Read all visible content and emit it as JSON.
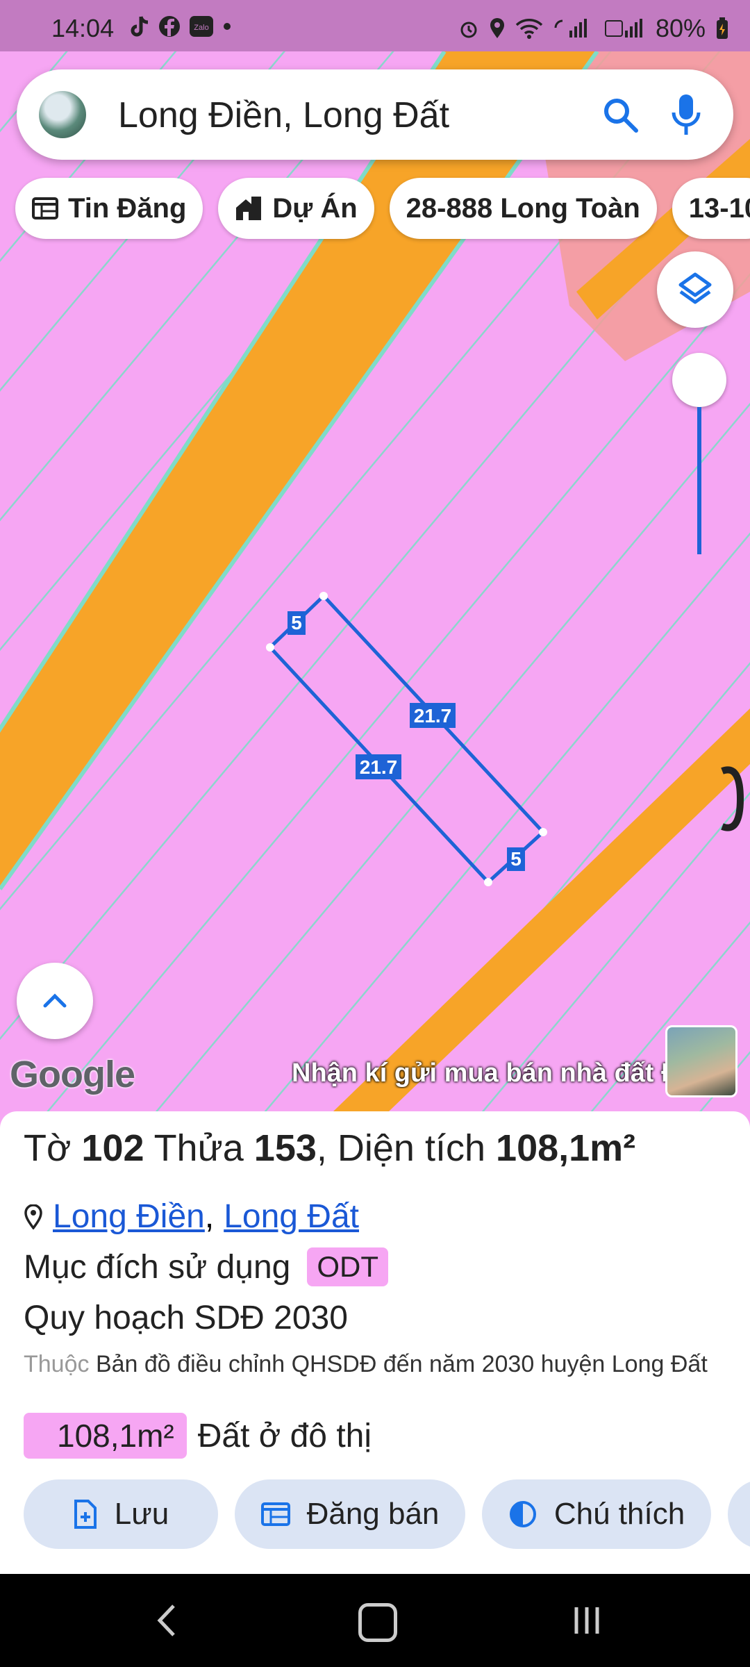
{
  "status_bar": {
    "time": "14:04",
    "battery": "80%",
    "app_icons": [
      "tiktok-icon",
      "facebook-icon",
      "zalo-icon"
    ],
    "zalo_label": "Zalo"
  },
  "search": {
    "text": "Long Điền, Long Đất"
  },
  "chips": [
    {
      "label": "Tin Đăng",
      "icon": "listing-icon"
    },
    {
      "label": "Dự Án",
      "icon": "project-icon"
    },
    {
      "label": "28-888 Long Toàn",
      "icon": ""
    },
    {
      "label": "13-10",
      "icon": ""
    }
  ],
  "map": {
    "parcel_labels": {
      "short_top": "5",
      "long_right": "21.7",
      "long_left": "21.7",
      "short_bottom": "5"
    },
    "google_logo": "Google",
    "watermark": "Nhận kí gửi mua bán nhà đất Đất Đỏ",
    "colors": {
      "residential": "#f6a6f3",
      "road": "#f7a428",
      "boundary": "#1e63d6",
      "parcel_lines": "#7fdcc8"
    }
  },
  "sheet": {
    "title": {
      "to_label": "Tờ",
      "to_value": "102",
      "thua_label": "Thửa",
      "thua_value": "153",
      "area_label": "Diện tích",
      "area_value": "108,1m²"
    },
    "location": {
      "district": "Long Điền",
      "sep": ",",
      "province": "Long Đất"
    },
    "purpose": {
      "label": "Mục đích sử dụng",
      "code": "ODT"
    },
    "plan_title": "Quy hoạch SDĐ 2030",
    "note": {
      "prefix": "Thuộc",
      "text": "Bản đồ điều chỉnh QHSDĐ đến năm 2030 huyện Long Đất"
    },
    "area_row": {
      "value": "108,1m²",
      "desc": "Đất ở đô thị"
    },
    "actions": [
      {
        "label": "Lưu",
        "icon": "save-icon"
      },
      {
        "label": "Đăng bán",
        "icon": "post-sale-icon"
      },
      {
        "label": "Chú thích",
        "icon": "legend-icon"
      }
    ]
  }
}
